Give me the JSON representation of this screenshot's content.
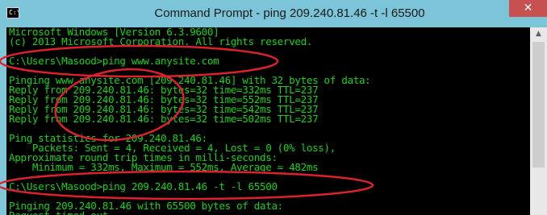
{
  "window": {
    "title": "Command Prompt - ping  209.240.81.46 -t -l 65500",
    "app_icon_text": "C:\\",
    "close_symbol": "✕"
  },
  "console": {
    "lines": [
      "Microsoft Windows [Version 6.3.9600]",
      "(c) 2013 Microsoft Corporation. All rights reserved.",
      "",
      "C:\\Users\\Masood>ping www.anysite.com",
      "",
      "Pinging www.anysite.com [209.240.81.46] with 32 bytes of data:",
      "Reply from 209.240.81.46: bytes=32 time=332ms TTL=237",
      "Reply from 209.240.81.46: bytes=32 time=552ms TTL=237",
      "Reply from 209.240.81.46: bytes=32 time=542ms TTL=237",
      "Reply from 209.240.81.46: bytes=32 time=502ms TTL=237",
      "",
      "Ping statistics for 209.240.81.46:",
      "    Packets: Sent = 4, Received = 4, Lost = 0 (0% loss),",
      "Approximate round trip times in milli-seconds:",
      "    Minimum = 332ms, Maximum = 552ms, Average = 482ms",
      "",
      "C:\\Users\\Masood>ping 209.240.81.46 -t -l 65500",
      "",
      "Pinging 209.240.81.46 with 65500 bytes of data:",
      "Request timed out."
    ]
  },
  "colors": {
    "console_text": "#15d415",
    "console_bg": "#000000",
    "annotation": "#e0202a",
    "titlebar": "#7cc4d7",
    "close_button": "#c75050"
  }
}
